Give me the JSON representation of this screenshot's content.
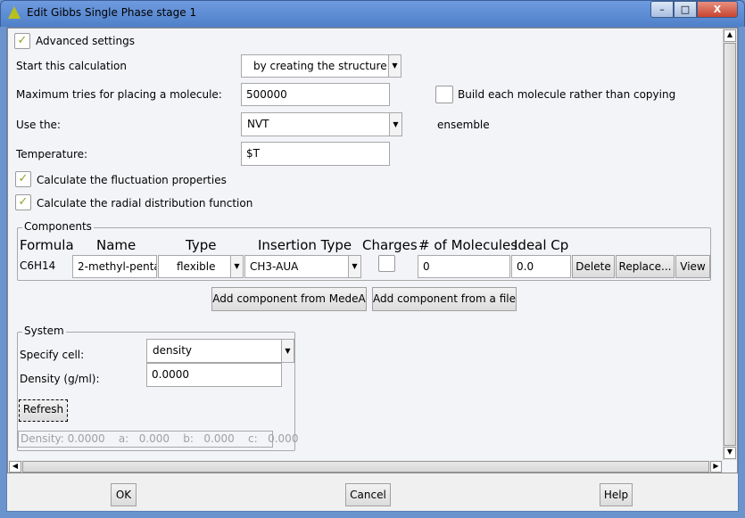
{
  "window": {
    "title": "Edit Gibbs Single Phase stage 1",
    "minimize": "–",
    "maximize": "□",
    "close": "X"
  },
  "settings": {
    "advanced": {
      "label": "Advanced settings",
      "checked": true
    },
    "start_label": "Start this calculation",
    "start_value": "by creating the structure",
    "max_tries_label": "Maximum tries for placing a molecule:",
    "max_tries_value": "500000",
    "build_label": "Build each molecule rather than copying",
    "build_checked": false,
    "use_label": "Use the:",
    "ensemble_value": "NVT",
    "ensemble_suffix": "ensemble",
    "temperature_label": "Temperature:",
    "temperature_value": "$T",
    "fluct": {
      "label": "Calculate the fluctuation properties",
      "checked": true
    },
    "rdf": {
      "label": "Calculate the radial distribution function",
      "checked": true
    }
  },
  "components": {
    "legend": "Components",
    "headers": [
      "Formula",
      "Name",
      "Type",
      "Insertion Type",
      "Charges",
      "# of Molecules",
      "Ideal Cp"
    ],
    "row": {
      "formula": "C6H14",
      "name": "2-methyl-penta",
      "type": "flexible",
      "insertion": "CH3-AUA",
      "charges": false,
      "molecules": "0",
      "ideal_cp": "0.0",
      "delete": "Delete",
      "replace": "Replace...",
      "view": "View"
    },
    "add_medea": "Add component from MedeA",
    "add_file": "Add component from a file"
  },
  "system": {
    "legend": "System",
    "specify_label": "Specify cell:",
    "specify_value": "density",
    "density_label": "Density (g/ml):",
    "density_value": "0.0000",
    "refresh": "Refresh",
    "summary": "Density: 0.0000    a:   0.000    b:   0.000    c:   0.000"
  },
  "footer": {
    "ok": "OK",
    "cancel": "Cancel",
    "help": "Help"
  },
  "accent": "#8aa520"
}
